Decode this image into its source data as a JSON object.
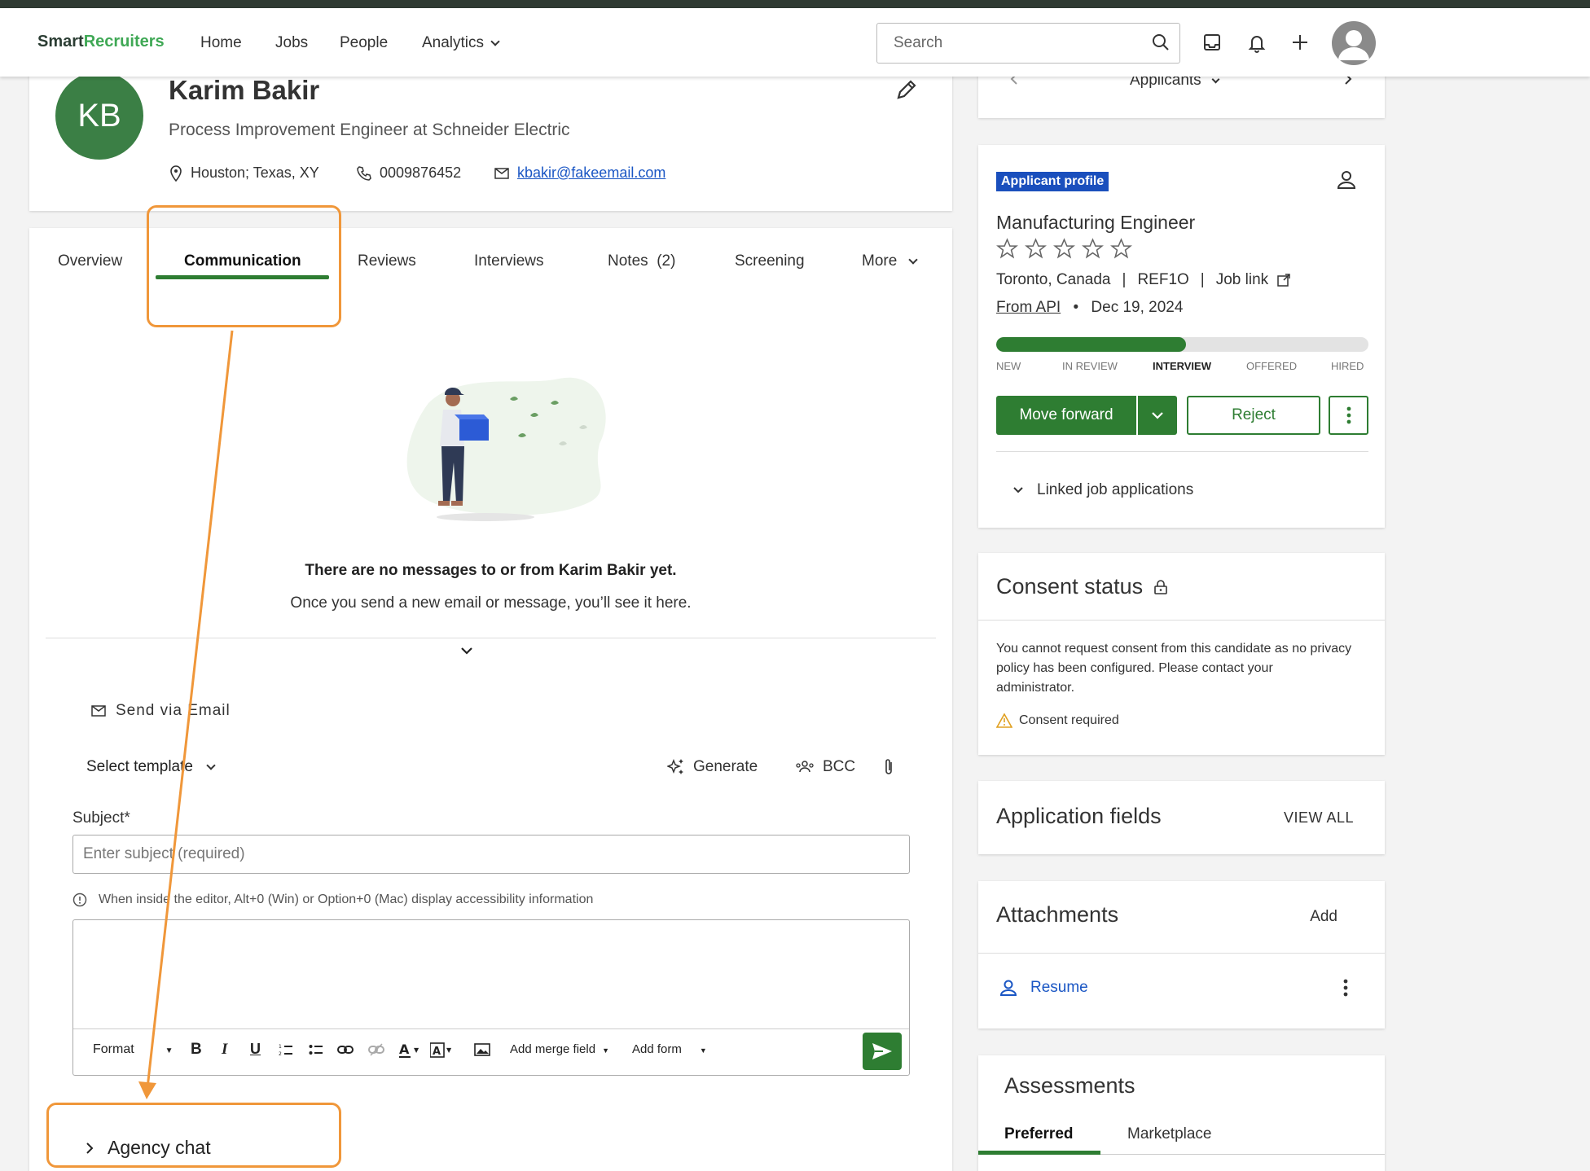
{
  "nav": {
    "logo_part1": "Smart",
    "logo_part2": "Recruiters",
    "items": [
      "Home",
      "Jobs",
      "People",
      "Analytics"
    ],
    "search_placeholder": "Search"
  },
  "candidate": {
    "initials": "KB",
    "name": "Karim Bakir",
    "title": "Process Improvement Engineer at Schneider Electric",
    "location": "Houston; Texas, XY",
    "phone": "0009876452",
    "email": "kbakir@fakeemail.com"
  },
  "tabs": [
    "Overview",
    "Communication",
    "Reviews",
    "Interviews",
    "Notes  (2)",
    "Screening",
    "More"
  ],
  "messages": {
    "empty_title": "There are no messages to or from Karim Bakir yet.",
    "empty_sub": "Once you send a new email or message, you’ll see it here."
  },
  "compose": {
    "send_via": "Send via Email",
    "template": "Select template",
    "generate": "Generate",
    "bcc": "BCC",
    "subject_label": "Subject*",
    "subject_placeholder": "Enter subject (required)",
    "a11y_hint": "When inside the editor, Alt+0 (Win) or Option+0 (Mac) display accessibility information",
    "toolbar": {
      "format": "Format",
      "bold": "B",
      "italic": "I",
      "underline": "U",
      "merge_field": "Add merge field",
      "add_form": "Add form"
    }
  },
  "agency_chat": "Agency chat",
  "applicants_nav": "Applicants",
  "application": {
    "badge": "Applicant profile",
    "job_title": "Manufacturing Engineer",
    "rating": 0,
    "location": "Toronto, Canada",
    "ref": "REF1O",
    "job_link": "Job link",
    "source": "From API",
    "date": "Dec 19, 2024",
    "progress_fraction": 0.51,
    "stages": [
      "NEW",
      "IN REVIEW",
      "INTERVIEW",
      "OFFERED",
      "HIRED"
    ],
    "active_stage": "INTERVIEW",
    "move_forward": "Move forward",
    "reject": "Reject",
    "linked": "Linked job applications"
  },
  "consent": {
    "title": "Consent status",
    "text": "You cannot request consent from this candidate as no privacy policy has been configured. Please contact your administrator.",
    "required": "Consent required"
  },
  "fields": {
    "title": "Application fields",
    "view_all": "VIEW ALL"
  },
  "attachments": {
    "title": "Attachments",
    "add": "Add",
    "resume": "Resume"
  },
  "assessments": {
    "title": "Assessments",
    "tabs": [
      "Preferred",
      "Marketplace"
    ]
  },
  "colors": {
    "brand_green": "#2e7d32",
    "highlight_orange": "#f0973a",
    "link_blue": "#1a56c4",
    "badge_blue": "#1a4fbd"
  }
}
